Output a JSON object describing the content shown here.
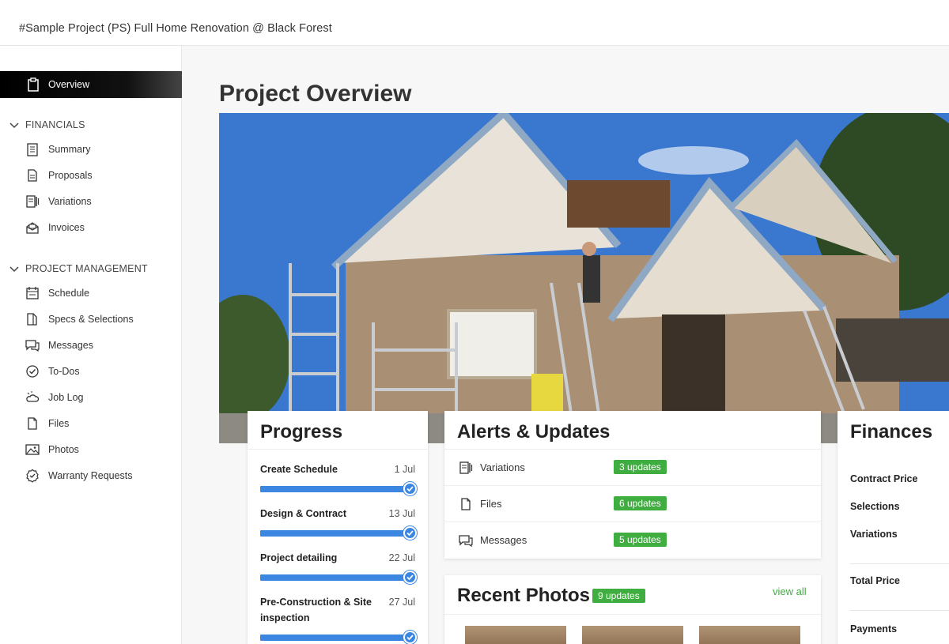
{
  "header": {
    "project_title": "#Sample Project (PS) Full Home Renovation @ Black Forest"
  },
  "sidebar": {
    "active_item": {
      "label": "Overview",
      "icon": "clipboard-icon"
    },
    "sections": [
      {
        "label": "FINANCIALS",
        "items": [
          {
            "label": "Summary",
            "icon": "summary-icon"
          },
          {
            "label": "Proposals",
            "icon": "document-icon"
          },
          {
            "label": "Variations",
            "icon": "variations-icon"
          },
          {
            "label": "Invoices",
            "icon": "invoice-icon"
          }
        ]
      },
      {
        "label": "PROJECT MANAGEMENT",
        "items": [
          {
            "label": "Schedule",
            "icon": "calendar-icon"
          },
          {
            "label": "Specs & Selections",
            "icon": "specs-icon"
          },
          {
            "label": "Messages",
            "icon": "messages-icon"
          },
          {
            "label": "To-Dos",
            "icon": "check-circle-icon"
          },
          {
            "label": "Job Log",
            "icon": "weather-icon"
          },
          {
            "label": "Files",
            "icon": "file-icon"
          },
          {
            "label": "Photos",
            "icon": "photo-icon"
          },
          {
            "label": "Warranty Requests",
            "icon": "badge-check-icon"
          }
        ]
      }
    ]
  },
  "main": {
    "title": "Project Overview",
    "progress": {
      "title": "Progress",
      "milestones": [
        {
          "name": "Create Schedule",
          "date": "1 Jul",
          "complete": 1.0
        },
        {
          "name": "Design & Contract",
          "date": "13 Jul",
          "complete": 1.0
        },
        {
          "name": "Project detailing",
          "date": "22 Jul",
          "complete": 1.0
        },
        {
          "name": "Pre-Construction & Site inspection",
          "date": "27 Jul",
          "complete": 1.0
        }
      ]
    },
    "alerts": {
      "title": "Alerts & Updates",
      "rows": [
        {
          "label": "Variations",
          "badge": "3 updates",
          "icon": "variations-icon"
        },
        {
          "label": "Files",
          "badge": "6 updates",
          "icon": "file-icon"
        },
        {
          "label": "Messages",
          "badge": "5 updates",
          "icon": "messages-icon"
        }
      ]
    },
    "photos": {
      "title": "Recent Photos",
      "badge": "9 updates",
      "view_all": "view all"
    },
    "finances": {
      "title": "Finances",
      "rows": [
        "Contract Price",
        "Selections",
        "Variations",
        "Total Price",
        "Payments"
      ]
    }
  },
  "colors": {
    "accent_green": "#3fad3f",
    "progress_blue": "#3b86e0",
    "active_nav": "#000000"
  }
}
